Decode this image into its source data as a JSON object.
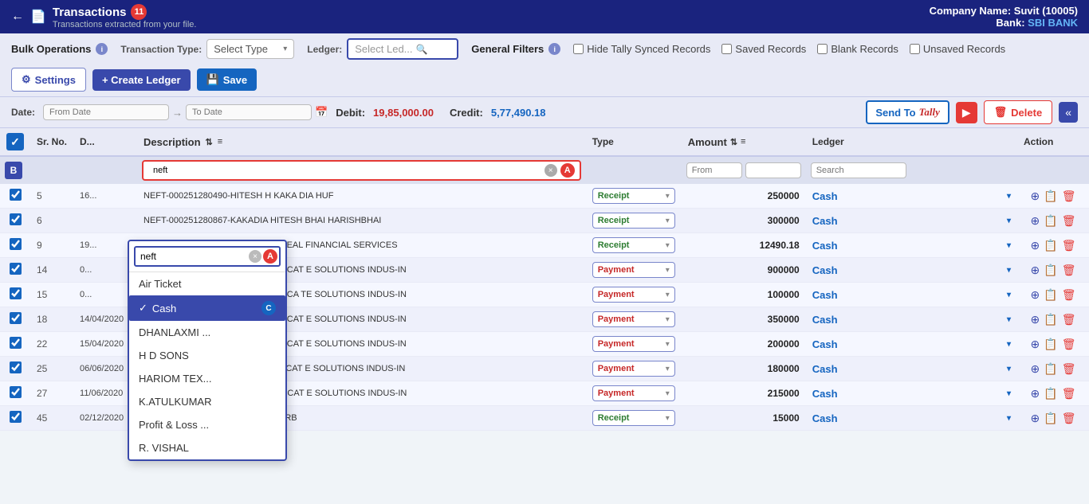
{
  "header": {
    "back_icon": "←",
    "title": "Transactions",
    "badge": "11",
    "subtitle": "Transactions extracted from your file.",
    "company_label": "Company Name:",
    "company_name": "Suvit (10005)",
    "bank_label": "Bank:",
    "bank_name": "SBI BANK"
  },
  "toolbar": {
    "bulk_operations": "Bulk Operations",
    "general_filters": "General Filters",
    "settings_label": "Settings",
    "create_ledger_label": "+ Create Ledger",
    "save_label": "Save",
    "send_to_label": "Send To",
    "tally_label": "Tally",
    "delete_label": "Delete",
    "hide_tally_label": "Hide Tally Synced Records",
    "saved_records_label": "Saved Records",
    "blank_records_label": "Blank Records",
    "unsaved_records_label": "Unsaved Records",
    "from_date_placeholder": "From Date",
    "to_date_placeholder": "To Date",
    "debit_label": "Debit:",
    "debit_value": "19,85,000.00",
    "credit_label": "Credit:",
    "credit_value": "5,77,490.18"
  },
  "filters": {
    "transaction_type_label": "Transaction Type:",
    "ledger_label": "Ledger:",
    "select_type_placeholder": "Select Type",
    "select_ledger_placeholder": "Select Led..."
  },
  "table": {
    "columns": [
      "",
      "Sr. No.",
      "D...",
      "Description",
      "Type",
      "Amount",
      "Ledger",
      "Action"
    ],
    "filter_row": {
      "search_desc": "neft",
      "from_amount": "From",
      "to_amount": "",
      "search_ledger": "Search"
    },
    "rows": [
      {
        "sr": "5",
        "date": "16...",
        "desc": "NEFT-000251280490-HITESH H KAKA DIA HUF",
        "type": "Receipt",
        "amount": "250000",
        "ledger": "Cash",
        "checked": true
      },
      {
        "sr": "6",
        "date": "",
        "desc": "NEFT-000251280867-KAKADIA HITESH BHAI HARISHBHAI",
        "type": "Receipt",
        "amount": "300000",
        "ledger": "Cash",
        "checked": true
      },
      {
        "sr": "9",
        "date": "19...",
        "desc": "NEFT-N079201098119745-TRADEDEAL FINANCIAL SERVICES",
        "type": "Receipt",
        "amount": "12490.18",
        "ledger": "Cash",
        "checked": true
      },
      {
        "sr": "14",
        "date": "0...",
        "desc": "NEFT-BARBV20094374736-CORUSCAT E SOLUTIONS INDUS-IN",
        "type": "Payment",
        "amount": "900000",
        "ledger": "Cash",
        "checked": true
      },
      {
        "sr": "15",
        "date": "0...",
        "desc": "NEFT-BARBV20094370372-CORUSCA TE SOLUTIONS INDUS-IN",
        "type": "Payment",
        "amount": "100000",
        "ledger": "Cash",
        "checked": true
      },
      {
        "sr": "18",
        "date": "14/04/2020",
        "desc": "NEFT-BARBP20105533512-CORUSCAT E SOLUTIONS INDUS-IN",
        "type": "Payment",
        "amount": "350000",
        "ledger": "Cash",
        "checked": true
      },
      {
        "sr": "22",
        "date": "15/04/2020",
        "desc": "NEFT-BARBP20106669546-CORUSCAT E SOLUTIONS INDUS-IN",
        "type": "Payment",
        "amount": "200000",
        "ledger": "Cash",
        "checked": true
      },
      {
        "sr": "25",
        "date": "06/06/2020",
        "desc": "NEFT-BARBZ20158636511-CORUSCAT E SOLUTIONS INDUS-IN",
        "type": "Payment",
        "amount": "180000",
        "ledger": "Cash",
        "checked": true
      },
      {
        "sr": "27",
        "date": "11/06/2020",
        "desc": "NEFT-BARBR20163390846-CORUSCAT E SOLUTIONS INDUS-IN",
        "type": "Payment",
        "amount": "215000",
        "ledger": "Cash",
        "checked": true
      },
      {
        "sr": "45",
        "date": "02/12/2020",
        "desc": "NEFT-000303204526-HINSONS CARB",
        "type": "Receipt",
        "amount": "15000",
        "ledger": "Cash",
        "checked": true
      }
    ]
  },
  "dropdown": {
    "search_value": "neft",
    "items": [
      {
        "label": "Air Ticket",
        "selected": false
      },
      {
        "label": "Cash",
        "selected": true
      },
      {
        "label": "DHANLAXMI ...",
        "selected": false
      },
      {
        "label": "H D SONS",
        "selected": false
      },
      {
        "label": "HARIOM TEX...",
        "selected": false
      },
      {
        "label": "K.ATULKUMAR",
        "selected": false
      },
      {
        "label": "Profit & Loss ...",
        "selected": false
      },
      {
        "label": "R. VISHAL",
        "selected": false
      }
    ],
    "clear_btn": "×",
    "a_badge": "A",
    "c_badge": "C"
  }
}
